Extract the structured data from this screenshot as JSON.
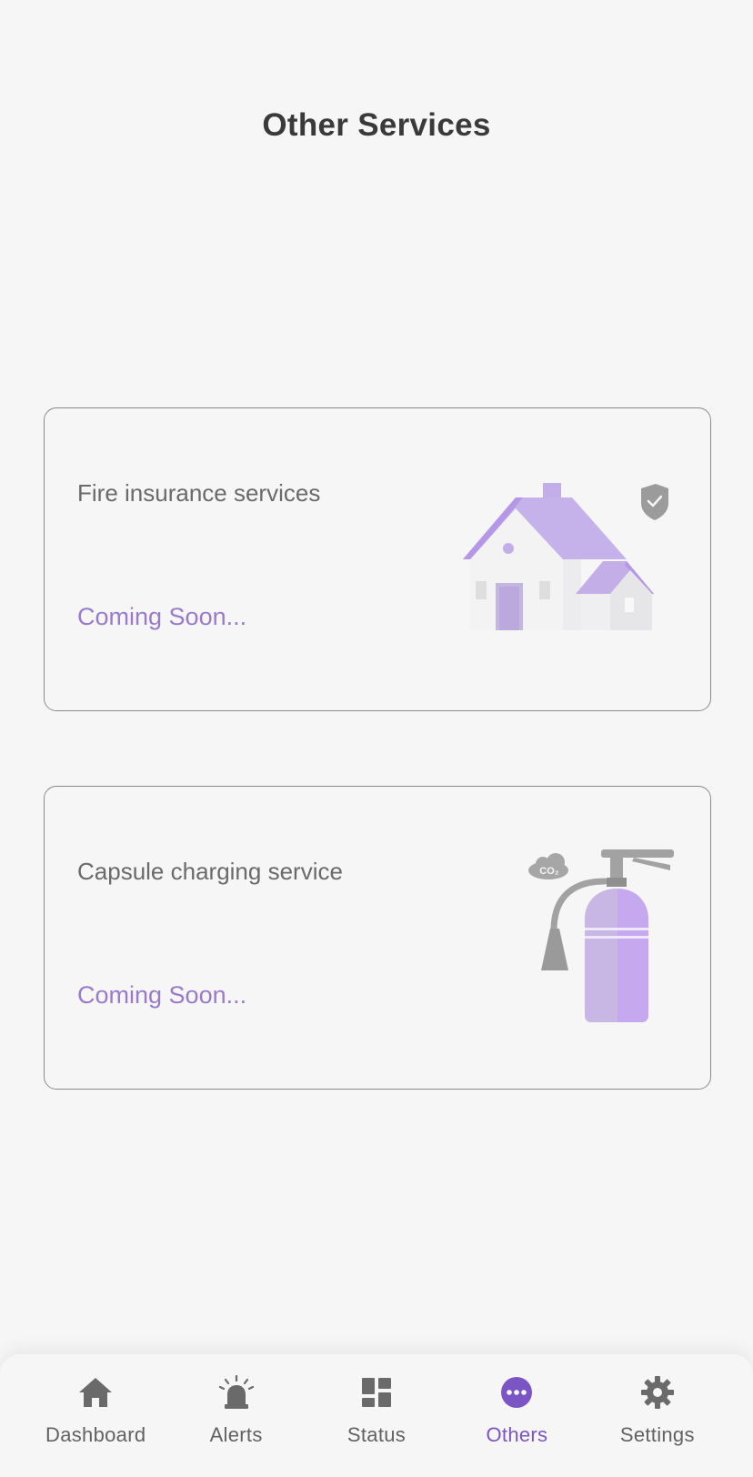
{
  "header": {
    "title": "Other Services"
  },
  "cards": [
    {
      "title": "Fire insurance services",
      "status": "Coming Soon...",
      "illustration": "house-shield-icon"
    },
    {
      "title": "Capsule charging service",
      "status": "Coming Soon...",
      "illustration": "fire-extinguisher-icon",
      "badge": "CO₂"
    }
  ],
  "nav": {
    "active": "Others",
    "items": [
      {
        "label": "Dashboard",
        "icon": "home-icon"
      },
      {
        "label": "Alerts",
        "icon": "siren-icon"
      },
      {
        "label": "Status",
        "icon": "grid-icon"
      },
      {
        "label": "Others",
        "icon": "more-icon"
      },
      {
        "label": "Settings",
        "icon": "gear-icon"
      }
    ]
  },
  "colors": {
    "accent": "#7b55c4",
    "accent_light": "#c3aee8",
    "text": "#3a3a3a",
    "muted": "#6a6a6a"
  }
}
